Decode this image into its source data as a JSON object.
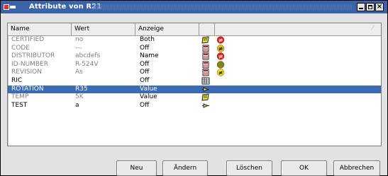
{
  "window": {
    "title": "Attribute von R21"
  },
  "table": {
    "columns": [
      "Name",
      "Wert",
      "Anzeige"
    ],
    "rows": [
      {
        "name": "CERTIFIED",
        "wert": "no",
        "anzeige": "Both",
        "style": "muted",
        "icon": "folder-note-icon",
        "status": "not-equal-red-circle-icon",
        "status_color": "#e02020",
        "status_symbol": "≠"
      },
      {
        "name": "CODE",
        "wert": "---",
        "anzeige": "Off",
        "style": "muted",
        "icon": "page-icon",
        "status": "not-equal-yellow-circle-icon",
        "status_color": "#e4c020",
        "status_symbol": "≠"
      },
      {
        "name": "DISTRIBUTOR",
        "wert": "abcdefs",
        "anzeige": "Name",
        "style": "muted",
        "icon": "page-icon",
        "status": "not-equal-red-circle-icon",
        "status_color": "#e02020",
        "status_symbol": "≠"
      },
      {
        "name": "ID-NUMBER",
        "wert": "R-524V",
        "anzeige": "Off",
        "style": "muted",
        "icon": "page-icon",
        "status": "olive-circle-icon",
        "status_color": "#857f1d",
        "status_symbol": ""
      },
      {
        "name": "REVISION",
        "wert": "As",
        "anzeige": "Off",
        "style": "muted",
        "icon": "page-icon",
        "status": "not-equal-yellow-circle-icon",
        "status_color": "#f0e020",
        "status_symbol": "≠"
      },
      {
        "name": "RIC",
        "wert": "",
        "anzeige": "Off",
        "style": "dark",
        "icon": "grid-icon",
        "status": "",
        "status_color": "",
        "status_symbol": ""
      },
      {
        "name": "ROTATION",
        "wert": "R35",
        "anzeige": "Value",
        "style": "selected",
        "icon": "pin-icon",
        "status": "",
        "status_color": "",
        "status_symbol": ""
      },
      {
        "name": "TEMP",
        "wert": "5K",
        "anzeige": "Value",
        "style": "muted",
        "icon": "folder-note-icon",
        "status": "",
        "status_color": "",
        "status_symbol": ""
      },
      {
        "name": "TEST",
        "wert": "a",
        "anzeige": "Off",
        "style": "dark",
        "icon": "pin-icon",
        "status": "",
        "status_color": "",
        "status_symbol": ""
      }
    ]
  },
  "buttons": {
    "neu": "Neu",
    "aendern": "Ändern",
    "loeschen": "Löschen",
    "ok": "OK",
    "abbrechen": "Abbrechen"
  },
  "colors": {
    "titlebar": "#3a63a9",
    "selection": "#3b6bb5"
  }
}
